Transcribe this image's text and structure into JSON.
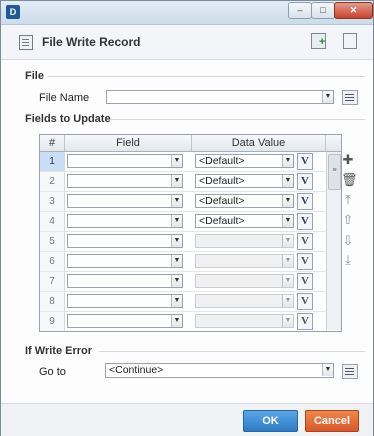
{
  "titlebar": {
    "app_icon": "D",
    "minimize": "–",
    "maximize": "□",
    "close": "✕"
  },
  "header": {
    "title": "File Write Record"
  },
  "file_section": {
    "label": "File",
    "file_name_label": "File Name",
    "file_name_value": ""
  },
  "fields_section": {
    "label": "Fields to Update",
    "columns": [
      "#",
      "Field",
      "Data Value"
    ],
    "rows": [
      {
        "num": "1",
        "field": "",
        "value": "<Default>",
        "enabled": true
      },
      {
        "num": "2",
        "field": "",
        "value": "<Default>",
        "enabled": true
      },
      {
        "num": "3",
        "field": "",
        "value": "<Default>",
        "enabled": true
      },
      {
        "num": "4",
        "field": "",
        "value": "<Default>",
        "enabled": true
      },
      {
        "num": "5",
        "field": "",
        "value": "",
        "enabled": false
      },
      {
        "num": "6",
        "field": "",
        "value": "",
        "enabled": false
      },
      {
        "num": "7",
        "field": "",
        "value": "",
        "enabled": false
      },
      {
        "num": "8",
        "field": "",
        "value": "",
        "enabled": false
      },
      {
        "num": "9",
        "field": "",
        "value": "",
        "enabled": false
      }
    ],
    "variable_button": "V"
  },
  "error_section": {
    "label": "If Write Error",
    "goto_label": "Go to",
    "goto_value": "<Continue>"
  },
  "footer": {
    "ok_label": "OK",
    "cancel_label": "Cancel"
  },
  "side_tools": [
    "add-icon",
    "delete-icon",
    "move-top-icon",
    "move-up-icon",
    "move-down-icon",
    "move-bottom-icon"
  ],
  "colors": {
    "ok": "#2b7cc7",
    "cancel": "#d9582a",
    "selected_row": "#c9def4"
  }
}
